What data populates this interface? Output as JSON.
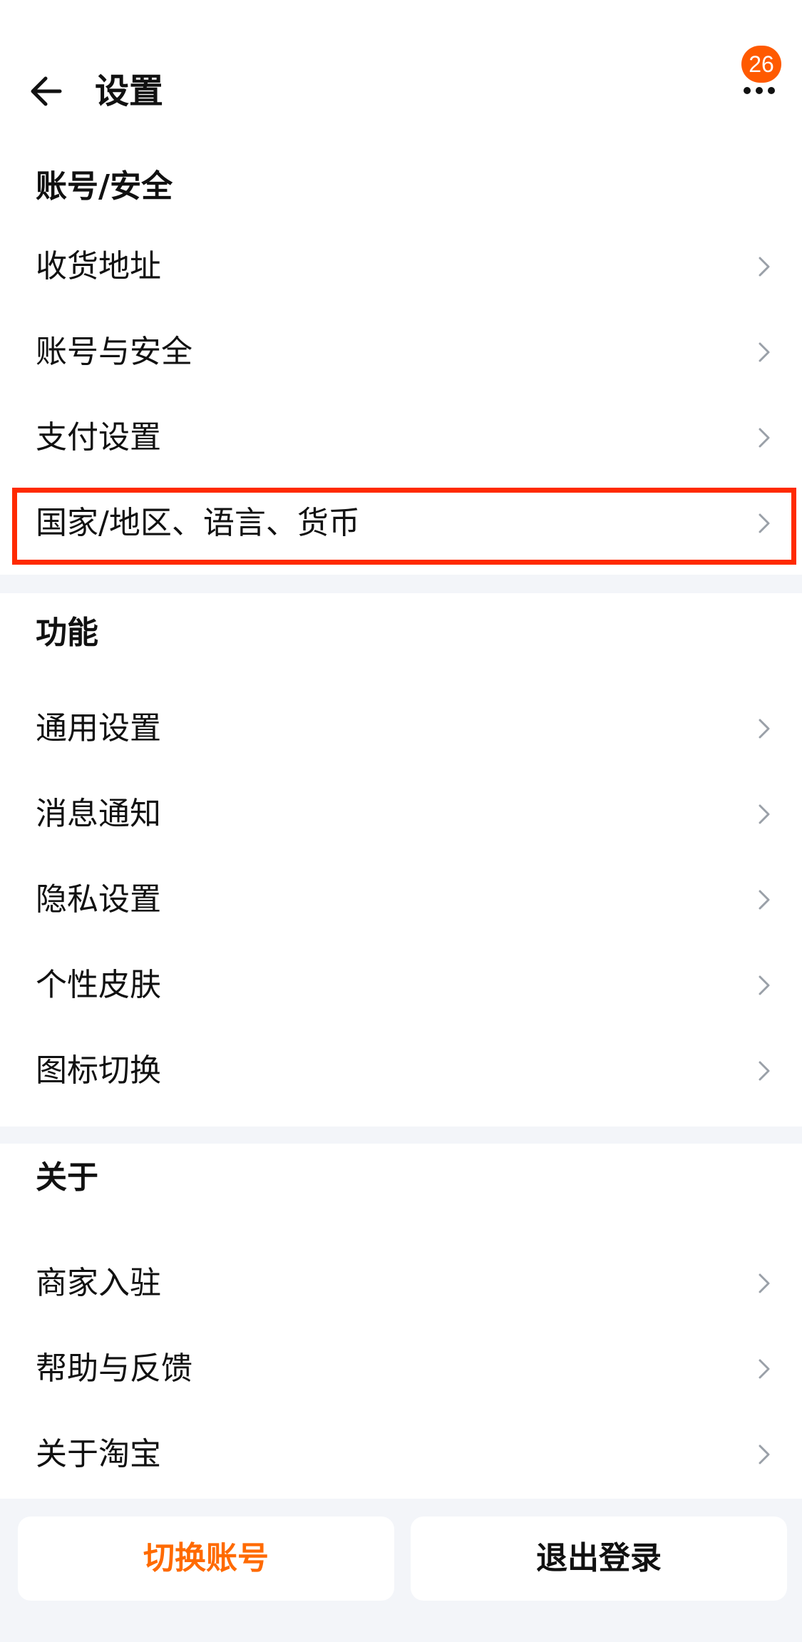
{
  "header": {
    "title": "设置",
    "back_icon": "arrow-left-icon",
    "more_icon": "more-horizontal-icon",
    "notification_count": "26",
    "badge_color": "#ff5a00"
  },
  "sections": [
    {
      "title": "账号/安全",
      "items": [
        {
          "label": "收货地址"
        },
        {
          "label": "账号与安全"
        },
        {
          "label": "支付设置"
        },
        {
          "label": "国家/地区、语言、货币"
        }
      ]
    },
    {
      "title": "功能",
      "items": [
        {
          "label": "通用设置"
        },
        {
          "label": "消息通知"
        },
        {
          "label": "隐私设置"
        },
        {
          "label": "个性皮肤"
        },
        {
          "label": "图标切换"
        }
      ]
    },
    {
      "title": "关于",
      "items": [
        {
          "label": "商家入驻"
        },
        {
          "label": "帮助与反馈"
        },
        {
          "label": "关于淘宝"
        }
      ]
    }
  ],
  "buttons": {
    "switch_account": "切换账号",
    "logout": "退出登录"
  },
  "colors": {
    "accent": "#ff6a00",
    "highlight_border": "#ff2a00",
    "page_background": "#f3f5f9"
  }
}
